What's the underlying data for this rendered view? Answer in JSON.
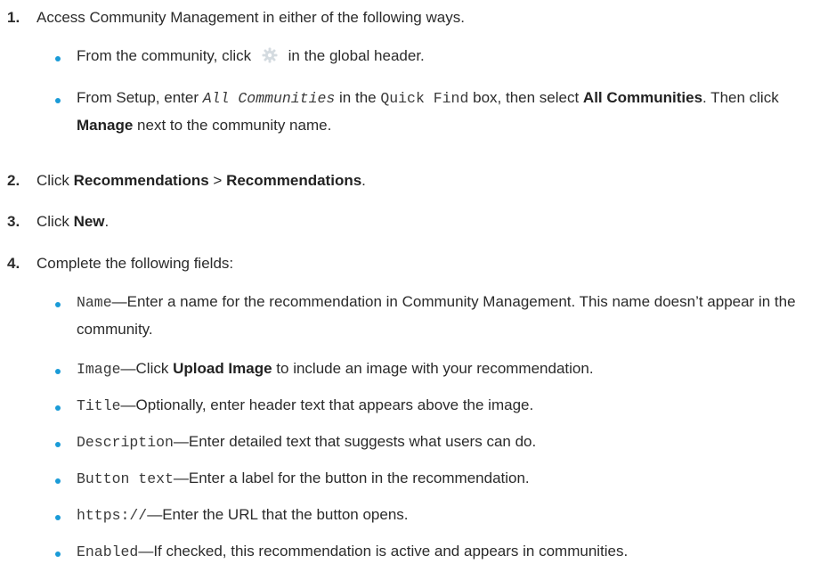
{
  "steps": [
    {
      "number": "1.",
      "text": "Access Community Management in either of the following ways.",
      "bullets": [
        {
          "before": "From the community, click",
          "icon": "gear-icon",
          "after": "in the global header."
        },
        {
          "p1": "From Setup, enter",
          "code1": "All Communities",
          "p2": "in the",
          "code2": "Quick Find",
          "p3": "box, then select",
          "bold1": "All Communities",
          "p4": ". Then click",
          "bold2": "Manage",
          "p5": "next to the community name."
        }
      ]
    },
    {
      "number": "2.",
      "p1": "Click",
      "bold1": "Recommendations",
      "sep": ">",
      "bold2": "Recommendations",
      "end": "."
    },
    {
      "number": "3.",
      "p1": "Click",
      "bold1": "New",
      "end": "."
    },
    {
      "number": "4.",
      "text": "Complete the following fields:",
      "fields": [
        {
          "name": "Name",
          "desc": "—Enter a name for the recommendation in Community Management. This name doesn’t appear in the community."
        },
        {
          "name": "Image",
          "desc_before": "—Click",
          "bold": "Upload Image",
          "desc_after": "to include an image with your recommendation."
        },
        {
          "name": "Title",
          "desc": "—Optionally, enter header text that appears above the image."
        },
        {
          "name": "Description",
          "desc": "—Enter detailed text that suggests what users can do."
        },
        {
          "name": "Button text",
          "desc": "—Enter a label for the button in the recommendation."
        },
        {
          "name": "https://",
          "desc": "—Enter the URL that the button opens."
        },
        {
          "name": "Enabled",
          "desc": "—If checked, this recommendation is active and appears in communities."
        }
      ]
    }
  ],
  "colors": {
    "bullet": "#1a9bd7",
    "text": "#2b2b2b"
  }
}
